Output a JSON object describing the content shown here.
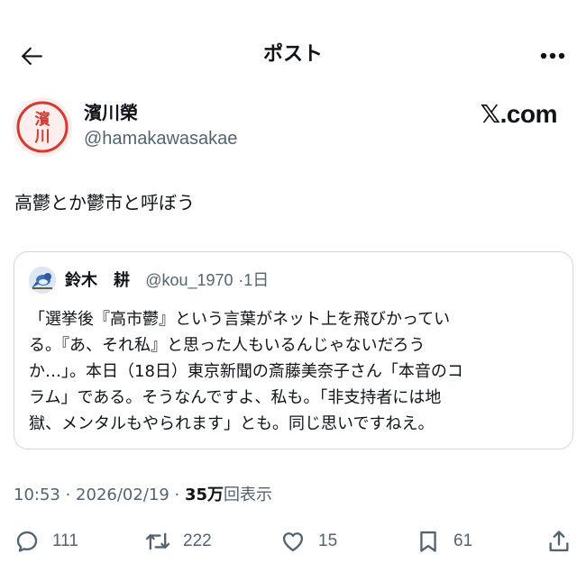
{
  "header": {
    "title": "ポスト",
    "back_icon": "arrow-left-icon",
    "more_icon": "more-horizontal-icon"
  },
  "author": {
    "name": "濱川榮",
    "handle": "@hamakawasakae",
    "avatar_text": "濱川",
    "avatar_color": "#d43a2f"
  },
  "brand": {
    "text": "𝕏.com"
  },
  "post": {
    "text": "高鬱とか鬱市と呼ぼう"
  },
  "quote": {
    "name": "鈴木　耕",
    "handle": "@kou_1970",
    "time": "·1日",
    "lines": [
      "「選挙後『高市鬱』という言葉がネット上を飛びかってい",
      "る。『あ、それ私』と思った人もいるんじゃないだろう",
      "か…」。本日（18日）東京新聞の斎藤美奈子さん「本音のコ",
      "ラム」である。そうなんですよ、私も。「非支持者には地",
      "獄、メンタルもやられます」とも。同じ思いですねえ。"
    ]
  },
  "meta": {
    "time": "10:53 · 2026/02/19 · ",
    "views_count": "35万",
    "views_label": "回表示"
  },
  "actions": {
    "reply": "111",
    "repost": "222",
    "like": "15",
    "bookmark": "61"
  },
  "colors": {
    "text": "#0f1419",
    "secondary": "#536471",
    "border": "#cfd9de"
  }
}
